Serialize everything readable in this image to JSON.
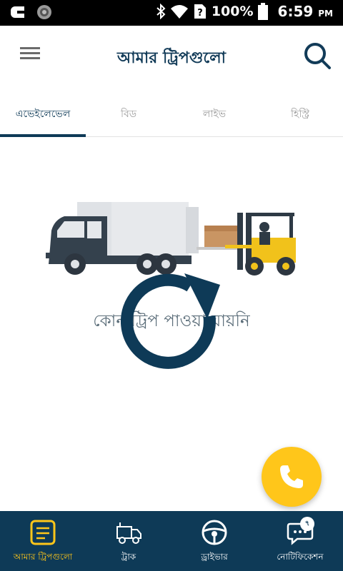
{
  "status_bar": {
    "battery_percent": "100%",
    "time": "6:59",
    "time_suffix": "PM"
  },
  "app_bar": {
    "title": "আমার ট্রিপগুলো",
    "menu_icon": "hamburger-menu-icon",
    "search_icon": "search-icon"
  },
  "tabs": [
    {
      "label": "এভেইলেভেল",
      "active": true
    },
    {
      "label": "বিড",
      "active": false
    },
    {
      "label": "লাইভ",
      "active": false
    },
    {
      "label": "হিস্ট্রি",
      "active": false
    }
  ],
  "content": {
    "empty_message": "কোন ট্রিপ পাওয়া যায়নি"
  },
  "fab": {
    "icon": "phone-icon"
  },
  "bottom_nav": {
    "items": [
      {
        "label": "আমার ট্রিপগুলো",
        "icon": "trips-note-icon",
        "active": true
      },
      {
        "label": "ট্রাক",
        "icon": "truck-icon",
        "active": false
      },
      {
        "label": "ড্রাইভার",
        "icon": "steering-wheel-icon",
        "active": false
      },
      {
        "label": "নোটিফিকেশন",
        "icon": "chat-notification-icon",
        "active": false,
        "badge": "৭"
      }
    ]
  },
  "colors": {
    "primary": "#0e3a57",
    "accent": "#ffc61a",
    "tab_inactive": "#9b9b9b"
  }
}
